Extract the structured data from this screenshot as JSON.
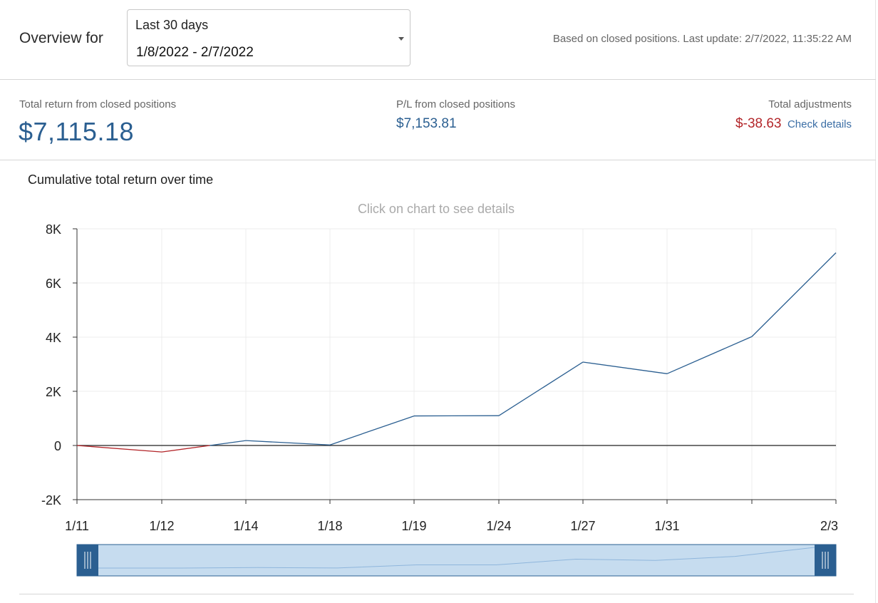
{
  "header": {
    "overview_label": "Overview for",
    "range_select": {
      "preset": "Last 30 days",
      "dates": "1/8/2022 - 2/7/2022",
      "caret_icon": "caret-down-icon"
    },
    "update_note": "Based on closed positions. Last update: 2/7/2022, 11:35:22 AM"
  },
  "summary": {
    "total_return": {
      "label": "Total return from closed positions",
      "value": "$7,115.18"
    },
    "pl": {
      "label": "P/L from closed positions",
      "value": "$7,153.81"
    },
    "adjustments": {
      "label": "Total adjustments",
      "value": "$-38.63",
      "link": "Check details"
    }
  },
  "chart": {
    "title": "Cumulative total return over time",
    "hint": "Click on chart to see details"
  },
  "colors": {
    "positive": "#2b5f91",
    "negative": "#b3262a",
    "label": "#666666",
    "link": "#3b6ea5"
  },
  "chart_data": {
    "type": "line",
    "title": "Cumulative total return over time",
    "x": [
      "1/11",
      "1/12",
      "1/14",
      "1/18",
      "1/19",
      "1/24",
      "1/27",
      "1/31",
      "",
      "2/3"
    ],
    "x_tick_labels": [
      "1/11",
      "1/12",
      "1/14",
      "1/18",
      "1/19",
      "1/24",
      "1/27",
      "1/31",
      "2/3"
    ],
    "values": [
      0,
      -240,
      180,
      20,
      1090,
      1100,
      3080,
      2650,
      4020,
      7115.18
    ],
    "y_tick_labels": [
      "8K",
      "6K",
      "4K",
      "2K",
      "0",
      "-2K"
    ],
    "ylim": [
      -2000,
      8000
    ],
    "grid": true,
    "negative_segments_color": "#b3262a",
    "positive_segments_color": "#2b5f91",
    "navigator": true
  }
}
